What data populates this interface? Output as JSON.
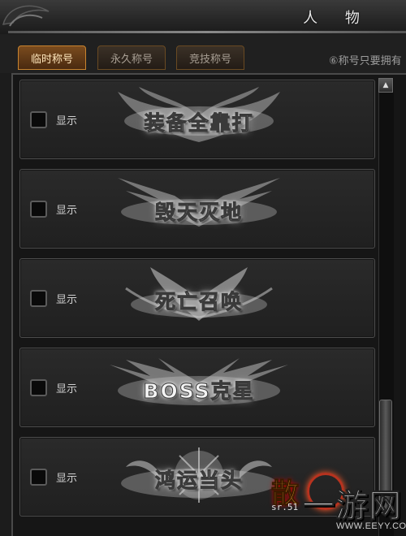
{
  "window": {
    "title": "人 物"
  },
  "tabs": [
    {
      "label": "临时称号",
      "active": true
    },
    {
      "label": "永久称号",
      "active": false
    },
    {
      "label": "竞技称号",
      "active": false
    }
  ],
  "hint": "⑥称号只要拥有",
  "titles": [
    {
      "name": "装备全靠打",
      "show_label": "显示",
      "checked": false
    },
    {
      "name": "毁天灭地",
      "show_label": "显示",
      "checked": false
    },
    {
      "name": "死亡召唤",
      "show_label": "显示",
      "checked": false
    },
    {
      "name": "BOSS克星",
      "show_label": "显示",
      "checked": false
    },
    {
      "name": "鸿运当头",
      "show_label": "显示",
      "checked": false
    }
  ],
  "scrollbar": {
    "up_arrow": "▲"
  },
  "watermark": {
    "brand_left": "散",
    "brand_main": "一游网",
    "sub": "sr.51",
    "url": "WWW.EEYY.COM"
  },
  "colors": {
    "accent": "#c7832f",
    "tab_active_text": "#ffe7bd",
    "panel_bg": "#1c1c1c"
  }
}
